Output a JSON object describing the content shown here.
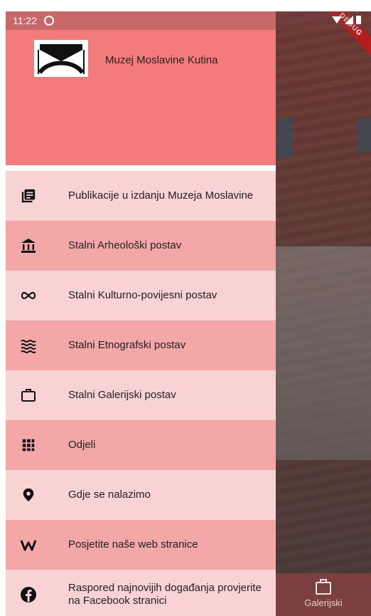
{
  "status_bar": {
    "time": "11:22"
  },
  "debug_banner": "DEBUG",
  "drawer": {
    "header_title": "Muzej Moslavine Kutina",
    "items": [
      {
        "label": "Publikacije u izdanju Muzeja Moslavine",
        "icon": "publications-icon"
      },
      {
        "label": "Stalni Arheološki postav",
        "icon": "museum-icon"
      },
      {
        "label": "Stalni Kulturno-povijesni postav",
        "icon": "infinity-icon"
      },
      {
        "label": "Stalni Etnografski postav",
        "icon": "waves-icon"
      },
      {
        "label": "Stalni Galerijski postav",
        "icon": "briefcase-icon"
      },
      {
        "label": "Odjeli",
        "icon": "grid-icon"
      },
      {
        "label": "Gdje se nalazimo",
        "icon": "location-pin-icon"
      },
      {
        "label": "Posjetite naše web stranice",
        "icon": "web-icon"
      },
      {
        "label": "Raspored najnovijih događanja provjerite na Facebook stranici",
        "icon": "facebook-icon"
      }
    ]
  },
  "bottom_nav": {
    "active_label": "Galerijski"
  }
}
